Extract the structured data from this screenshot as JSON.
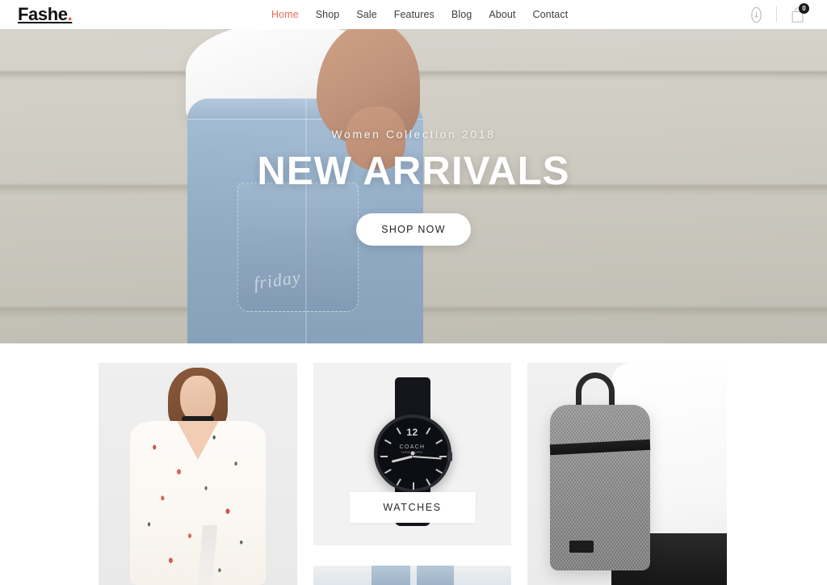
{
  "brand": {
    "name": "Fashe",
    "dot": ".",
    "accent_color": "#ef5b4c"
  },
  "nav": {
    "items": [
      {
        "label": "Home",
        "active": true
      },
      {
        "label": "Shop",
        "active": false
      },
      {
        "label": "Sale",
        "active": false
      },
      {
        "label": "Features",
        "active": false
      },
      {
        "label": "Blog",
        "active": false
      },
      {
        "label": "About",
        "active": false
      },
      {
        "label": "Contact",
        "active": false
      }
    ]
  },
  "header_tools": {
    "account_icon": "user-account-icon",
    "cart_icon": "shopping-bag-icon",
    "cart_count": "0"
  },
  "hero": {
    "eyebrow": "Women Collection 2018",
    "title": "NEW ARRIVALS",
    "cta_label": "SHOP NOW",
    "denim_script": "friday",
    "title_color": "#ffffff"
  },
  "categories": {
    "cards": [
      {
        "name": "floral-dress",
        "label": ""
      },
      {
        "name": "watch",
        "label": "WATCHES"
      },
      {
        "name": "jeans",
        "label": ""
      },
      {
        "name": "backpack",
        "label": ""
      }
    ],
    "watch_label": "WATCHES",
    "watch_brand": "COACH",
    "watch_brand_sub": "NEW YORK",
    "watch_hour_marker": "12"
  }
}
